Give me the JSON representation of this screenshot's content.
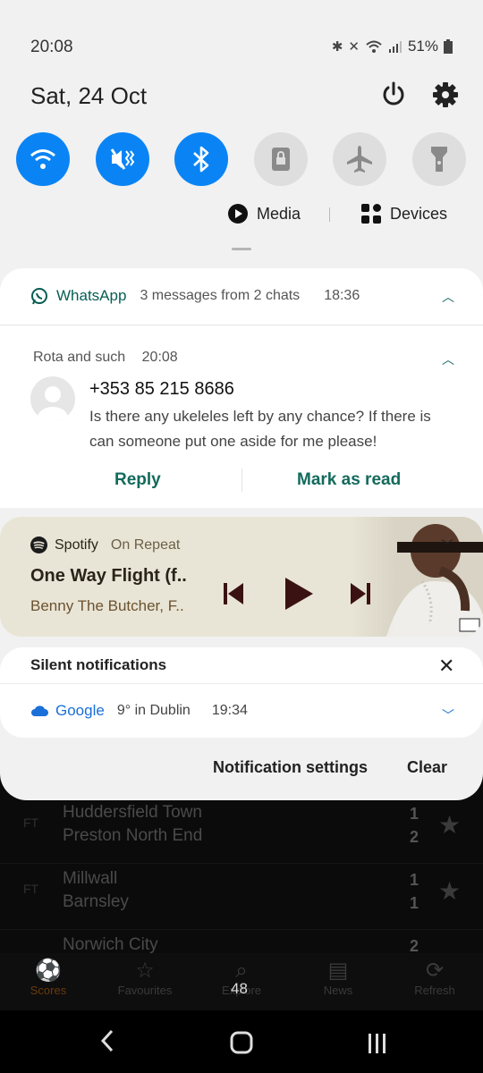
{
  "status_bar": {
    "time": "20:08",
    "battery": "51%",
    "icons": [
      "bluetooth-icon",
      "vibrate-icon",
      "wifi-icon",
      "signal-icon",
      "battery-icon"
    ]
  },
  "header": {
    "date": "Sat, 24 Oct",
    "icons": [
      "power-icon",
      "settings-icon"
    ]
  },
  "quick_settings": [
    {
      "name": "wifi",
      "icon": "wifi-icon",
      "state": "on"
    },
    {
      "name": "vibrate",
      "icon": "vibrate-icon",
      "state": "on"
    },
    {
      "name": "bluetooth",
      "icon": "bluetooth-icon",
      "state": "on"
    },
    {
      "name": "screen-lock",
      "icon": "lock-screen-icon",
      "state": "off"
    },
    {
      "name": "airplane",
      "icon": "airplane-icon",
      "state": "off"
    },
    {
      "name": "flashlight",
      "icon": "flashlight-icon",
      "state": "off"
    }
  ],
  "media_bar": {
    "media_label": "Media",
    "devices_label": "Devices"
  },
  "whatsapp": {
    "app": "WhatsApp",
    "summary": "3 messages from 2 chats",
    "time": "18:36",
    "group": "Rota and such",
    "group_time": "20:08",
    "sender": "+353 85 215 8686",
    "message": "Is there any ukeleles left by any chance? If there is can someone put one aside for me please!",
    "reply_label": "Reply",
    "mark_read_label": "Mark as read",
    "accent": "#075e54"
  },
  "spotify": {
    "app": "Spotify",
    "context": "On Repeat",
    "title": "One Way Flight (f..",
    "artist": "Benny The Butcher, F..",
    "background": "#e9e5d6",
    "controls": [
      "previous-icon",
      "play-icon",
      "next-icon"
    ]
  },
  "silent": {
    "title": "Silent notifications",
    "google_app": "Google",
    "google_text": "9° in Dublin",
    "google_time": "19:34",
    "accent": "#1a6fd8"
  },
  "footer": {
    "settings_label": "Notification settings",
    "clear_label": "Clear"
  },
  "background_app": {
    "matches": [
      {
        "status": "FT",
        "home": "Huddersfield Town",
        "away": "Preston North End",
        "home_score": "1",
        "away_score": "2"
      },
      {
        "status": "FT",
        "home": "Millwall",
        "away": "Barnsley",
        "home_score": "1",
        "away_score": "1"
      },
      {
        "status": "",
        "home": "Norwich City",
        "away": "",
        "home_score": "2",
        "away_score": ""
      }
    ],
    "nav": [
      {
        "label": "Scores",
        "icon": "soccer-ball-icon"
      },
      {
        "label": "Favourites",
        "icon": "star-icon"
      },
      {
        "label": "Explore",
        "icon": "search-list-icon"
      },
      {
        "label": "News",
        "icon": "newspaper-icon"
      },
      {
        "label": "Refresh",
        "icon": "refresh-icon"
      }
    ],
    "badge": "48"
  }
}
